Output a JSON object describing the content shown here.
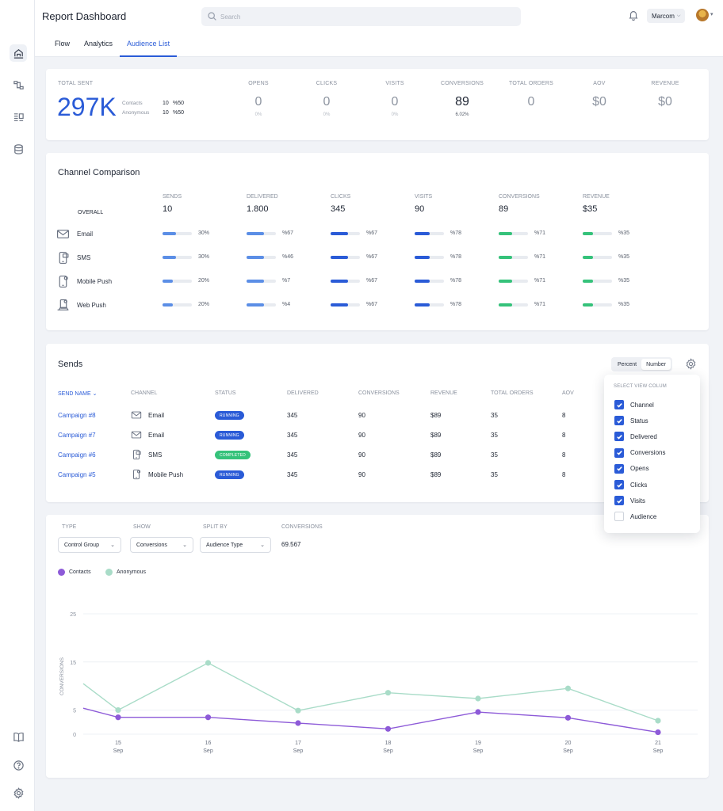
{
  "header": {
    "title": "Report Dashboard",
    "search_placeholder": "Search",
    "workspace": "Marcom",
    "tabs": [
      "Flow",
      "Analytics",
      "Audience List"
    ]
  },
  "summary": {
    "total_sent_label": "TOTAL SENT",
    "total_sent": "297K",
    "breakdown": [
      {
        "label": "Contacts",
        "count": "10",
        "pct": "%50"
      },
      {
        "label": "Anonymous",
        "count": "10",
        "pct": "%50"
      }
    ],
    "stats": [
      {
        "label": "OPENS",
        "value": "0",
        "sub": "0%"
      },
      {
        "label": "CLICKS",
        "value": "0",
        "sub": "0%"
      },
      {
        "label": "VISITS",
        "value": "0",
        "sub": "0%"
      },
      {
        "label": "CONVERSIONS",
        "value": "89",
        "sub": "6.02%"
      },
      {
        "label": "TOTAL ORDERS",
        "value": "0",
        "sub": ""
      },
      {
        "label": "AOV",
        "value": "$0",
        "sub": ""
      },
      {
        "label": "REVENUE",
        "value": "$0",
        "sub": ""
      }
    ]
  },
  "channel_comparison": {
    "title": "Channel Comparison",
    "overall_label": "OVERALL",
    "columns": [
      {
        "label": "SENDS",
        "overall": "10"
      },
      {
        "label": "DELIVERED",
        "overall": "1.800"
      },
      {
        "label": "CLICKS",
        "overall": "345"
      },
      {
        "label": "VISITS",
        "overall": "90"
      },
      {
        "label": "CONVERSIONS",
        "overall": "89"
      },
      {
        "label": "REVENUE",
        "overall": "$35"
      }
    ],
    "rows": [
      {
        "name": "Email",
        "icon": "mail-icon",
        "cells": [
          {
            "pct": "30%",
            "fill": 0.45
          },
          {
            "pct": "%67",
            "fill": 0.6
          },
          {
            "pct": "%67",
            "fill": 0.6
          },
          {
            "pct": "%78",
            "fill": 0.5
          },
          {
            "pct": "%71",
            "fill": 0.45
          },
          {
            "pct": "%35",
            "fill": 0.35
          }
        ]
      },
      {
        "name": "SMS",
        "icon": "sms-icon",
        "cells": [
          {
            "pct": "30%",
            "fill": 0.45
          },
          {
            "pct": "%46",
            "fill": 0.6
          },
          {
            "pct": "%67",
            "fill": 0.6
          },
          {
            "pct": "%78",
            "fill": 0.5
          },
          {
            "pct": "%71",
            "fill": 0.45
          },
          {
            "pct": "%35",
            "fill": 0.35
          }
        ]
      },
      {
        "name": "Mobile Push",
        "icon": "mobile-push-icon",
        "cells": [
          {
            "pct": "20%",
            "fill": 0.35
          },
          {
            "pct": "%7",
            "fill": 0.6
          },
          {
            "pct": "%67",
            "fill": 0.6
          },
          {
            "pct": "%78",
            "fill": 0.5
          },
          {
            "pct": "%71",
            "fill": 0.45
          },
          {
            "pct": "%35",
            "fill": 0.35
          }
        ]
      },
      {
        "name": "Web Push",
        "icon": "web-push-icon",
        "cells": [
          {
            "pct": "20%",
            "fill": 0.35
          },
          {
            "pct": "%4",
            "fill": 0.6
          },
          {
            "pct": "%67",
            "fill": 0.6
          },
          {
            "pct": "%78",
            "fill": 0.5
          },
          {
            "pct": "%71",
            "fill": 0.45
          },
          {
            "pct": "%35",
            "fill": 0.35
          }
        ]
      }
    ],
    "colors": [
      "#5b8ee6",
      "#5b8ee6",
      "#2a5bd7",
      "#2a5bd7",
      "#35c27a",
      "#35c27a"
    ]
  },
  "sends": {
    "title": "Sends",
    "toggle": [
      "Percent",
      "Number"
    ],
    "columns": [
      "SEND NAME",
      "CHANNEL",
      "STATUS",
      "DELIVERED",
      "CONVERSIONS",
      "REVENUE",
      "TOTAL ORDERS",
      "AOV"
    ],
    "rows": [
      {
        "name": "Campaign #8",
        "channel": "Email",
        "channel_icon": "mail-icon",
        "status": "RUNNING",
        "delivered": "345",
        "conversions": "90",
        "revenue": "$89",
        "orders": "35",
        "aov": "8"
      },
      {
        "name": "Campaign #7",
        "channel": "Email",
        "channel_icon": "mail-icon",
        "status": "RUNNING",
        "delivered": "345",
        "conversions": "90",
        "revenue": "$89",
        "orders": "35",
        "aov": "8"
      },
      {
        "name": "Campaign #6",
        "channel": "SMS",
        "channel_icon": "sms-icon",
        "status": "COMPLETED",
        "delivered": "345",
        "conversions": "90",
        "revenue": "$89",
        "orders": "35",
        "aov": "8"
      },
      {
        "name": "Campaign #5",
        "channel": "Mobile Push",
        "channel_icon": "mobile-push-icon",
        "status": "RUNNING",
        "delivered": "345",
        "conversions": "90",
        "revenue": "$89",
        "orders": "35",
        "aov": "8"
      }
    ],
    "status_colors": {
      "RUNNING": "#2a5bd7",
      "COMPLETED": "#35c27a"
    }
  },
  "column_picker": {
    "title": "SELECT VIEW COLUM",
    "options": [
      {
        "label": "Channel",
        "checked": true
      },
      {
        "label": "Status",
        "checked": true
      },
      {
        "label": "Delivered",
        "checked": true
      },
      {
        "label": "Conversions",
        "checked": true
      },
      {
        "label": "Opens",
        "checked": true
      },
      {
        "label": "Clicks",
        "checked": true
      },
      {
        "label": "Visits",
        "checked": true
      },
      {
        "label": "Audience",
        "checked": false
      }
    ]
  },
  "filters": {
    "type_label": "TYPE",
    "type_value": "Control Group",
    "show_label": "SHOW",
    "show_value": "Conversions",
    "split_label": "SPLIT BY",
    "split_value": "Audience Type",
    "conversions_label": "CONVERSIONS",
    "conversions_value": "69.567"
  },
  "chart_data": {
    "type": "line",
    "ylabel": "CONVERSIONS",
    "xlabel": "",
    "ylim": [
      0,
      25
    ],
    "yticks": [
      0,
      5,
      15,
      25
    ],
    "x": [
      "15 Sep",
      "16 Sep",
      "17 Sep",
      "18 Sep",
      "19 Sep",
      "20 Sep",
      "21 Sep"
    ],
    "x_day": [
      "15",
      "16",
      "17",
      "18",
      "19",
      "20",
      "21"
    ],
    "x_month": "Sep",
    "grid": true,
    "legend": "top-left",
    "series": [
      {
        "name": "Contacts",
        "color": "#8d5ad8",
        "start": 5.4,
        "values": [
          3.5,
          3.5,
          2.3,
          1.1,
          4.6,
          3.4,
          0.4
        ]
      },
      {
        "name": "Anonymous",
        "color": "#a9dcc8",
        "start": 10.5,
        "values": [
          5.0,
          14.8,
          4.9,
          8.6,
          7.4,
          9.5,
          2.8
        ]
      }
    ]
  }
}
